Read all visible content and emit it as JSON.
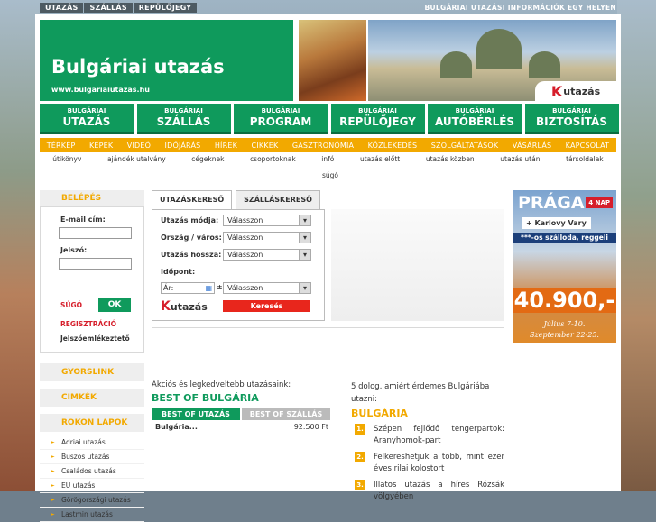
{
  "topbar": {
    "items": [
      "UTAZÁS",
      "SZÁLLÁS",
      "REPÜLŐJEGY"
    ],
    "tagline": "BULGÁRIAI UTAZÁSI INFORMÁCIÓK EGY HELYEN"
  },
  "header": {
    "title": "Bulgáriai utazás",
    "url": "www.bulgariaiutazas.hu",
    "logo_text": "utazás"
  },
  "mainnav": [
    {
      "small": "BULGÁRIAI",
      "big": "UTAZÁS"
    },
    {
      "small": "BULGÁRIAI",
      "big": "SZÁLLÁS"
    },
    {
      "small": "BULGÁRIAI",
      "big": "PROGRAM"
    },
    {
      "small": "BULGÁRIAI",
      "big": "REPÜLŐJEGY"
    },
    {
      "small": "BULGÁRIAI",
      "big": "AUTÓBÉRLÉS"
    },
    {
      "small": "BULGÁRIAI",
      "big": "BIZTOSÍTÁS"
    }
  ],
  "subnav": [
    "TÉRKÉP",
    "KÉPEK",
    "VIDEÓ",
    "IDŐJÁRÁS",
    "HÍREK",
    "CIKKEK",
    "GASZTRONÓMIA",
    "KÖZLEKEDÉS",
    "SZOLGÁLTATÁSOK",
    "VÁSÁRLÁS",
    "KAPCSOLAT"
  ],
  "subnav2": [
    "útikönyv",
    "ajándék utalvány",
    "cégeknek",
    "csoportoknak",
    "infó",
    "utazás előtt",
    "utazás közben",
    "utazás után",
    "társoldalak"
  ],
  "sugo_top": "súgó",
  "login": {
    "title": "BELÉPÉS",
    "email_label": "E-mail cím:",
    "password_label": "Jelszó:",
    "help": "SÚGÓ",
    "ok": "OK",
    "register": "REGISZTRÁCIÓ",
    "forgot": "Jelszóemlékeztető"
  },
  "sidebar": {
    "gyorslink": "GYORSLINK",
    "cimkek": "CIMKÉK",
    "rokon": "ROKON LAPOK",
    "links": [
      "Adriai utazás",
      "Buszos utazás",
      "Családos utazás",
      "EU utazás",
      "Görögországi utazás",
      "Lastmin utazás"
    ]
  },
  "search": {
    "tab_active": "UTAZÁSKERESŐ",
    "tab_inactive": "SZÁLLÁSKERESŐ",
    "mode_label": "Utazás módja:",
    "country_label": "Ország / város:",
    "length_label": "Utazás hossza:",
    "date_label": "Időpont:",
    "price_label": "Ár:",
    "pm": "±",
    "placeholder": "Válasszon",
    "button": "Keresés"
  },
  "promo": {
    "city": "PRÁGA",
    "days": "4 NAP",
    "extra": "+ Karlovy Vary",
    "hotel": "***-os szálloda, reggeli",
    "price": "40.900,-",
    "date1": "Július 7-10.",
    "date2": "Szeptember 22-25."
  },
  "offers": {
    "intro": "Akciós és legkedveltebb utazásaink:",
    "heading": "BEST OF BULGÁRIA",
    "tab1": "BEST OF UTAZÁS",
    "tab2": "BEST OF SZÁLLÁS",
    "row_name": "Bulgária...",
    "row_price": "92.500 Ft"
  },
  "reasons": {
    "intro": "5 dolog, amiért érdemes Bulgáriába utazni:",
    "heading": "BULGÁRIA",
    "items": [
      {
        "n": "1.",
        "text": "Szépen fejlődő tengerpartok: Aranyhomok-part"
      },
      {
        "n": "2.",
        "text": "Felkereshetjük a több, mint ezer éves rilai kolostort"
      },
      {
        "n": "3.",
        "text": "Illatos utazás a híres Rózsák völgyében"
      }
    ]
  }
}
